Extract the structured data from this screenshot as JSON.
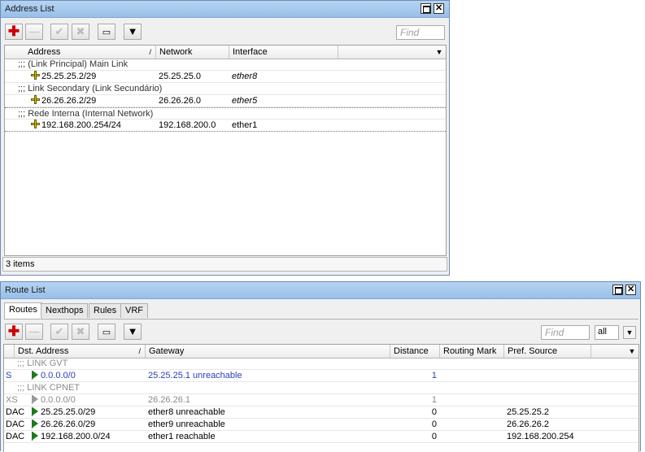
{
  "address_list": {
    "title": "Address List",
    "find_placeholder": "Find",
    "columns": [
      "Address",
      "Network",
      "Interface"
    ],
    "rows": [
      {
        "type": "comment",
        "text": ";;; (Link Principal) Main Link"
      },
      {
        "type": "entry",
        "address": "25.25.25.2/29",
        "network": "25.25.25.0",
        "interface": "ether8"
      },
      {
        "type": "comment",
        "text": ";;; Link Secondary (Link Secundário)"
      },
      {
        "type": "entry",
        "address": "26.26.26.2/29",
        "network": "26.26.26.0",
        "interface": "ether5"
      },
      {
        "type": "comment",
        "text": ";;; Rede Interna (Internal Network)"
      },
      {
        "type": "entry",
        "address": "192.168.200.254/24",
        "network": "192.168.200.0",
        "interface": "ether1"
      }
    ],
    "status": "3 items"
  },
  "route_list": {
    "title": "Route List",
    "tabs": [
      "Routes",
      "Nexthops",
      "Rules",
      "VRF"
    ],
    "find_placeholder": "Find",
    "filter_value": "all",
    "columns": [
      "Dst. Address",
      "Gateway",
      "Distance",
      "Routing Mark",
      "Pref. Source"
    ],
    "rows": [
      {
        "type": "comment",
        "text": ";;; LINK GVT"
      },
      {
        "flags": "S",
        "dst": "0.0.0.0/0",
        "gateway": "25.25.25.1 unreachable",
        "distance": "1",
        "mark": "",
        "pref": ""
      },
      {
        "type": "comment",
        "text": ";;; LINK CPNET"
      },
      {
        "flags": "XS",
        "dst": "0.0.0.0/0",
        "gateway": "26.26.26.1",
        "distance": "1",
        "mark": "",
        "pref": ""
      },
      {
        "flags": "DAC",
        "dst": "25.25.25.0/29",
        "gateway": "ether8 unreachable",
        "distance": "0",
        "mark": "",
        "pref": "25.25.25.2"
      },
      {
        "flags": "DAC",
        "dst": "26.26.26.0/29",
        "gateway": "ether9 unreachable",
        "distance": "0",
        "mark": "",
        "pref": "26.26.26.2"
      },
      {
        "flags": "DAC",
        "dst": "192.168.200.0/24",
        "gateway": "ether1 reachable",
        "distance": "0",
        "mark": "",
        "pref": "192.168.200.254"
      }
    ]
  }
}
